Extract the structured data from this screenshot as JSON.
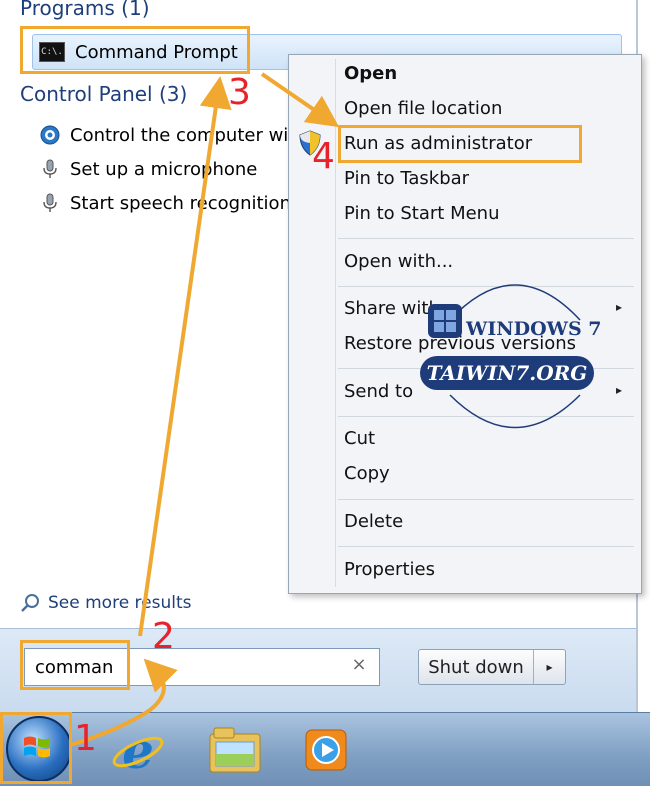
{
  "start_menu": {
    "programs_header": "Programs (1)",
    "command_prompt_label": "Command Prompt",
    "command_prompt_icon_text": "C:\\.",
    "control_panel_header": "Control Panel (3)",
    "control_items": [
      "Control the computer with",
      "Set up a microphone",
      "Start speech recognition"
    ],
    "see_more": "See more results",
    "search_value": "comman",
    "clear_symbol": "×",
    "shutdown_label": "Shut down",
    "shutdown_arrow": "▸"
  },
  "context_menu": {
    "items": [
      {
        "label": "Open",
        "bold": true
      },
      {
        "label": "Open file location"
      },
      {
        "label": "Run as administrator"
      },
      {
        "label": "Pin to Taskbar"
      },
      {
        "label": "Pin to Start Menu"
      },
      {
        "label": "Open with..."
      },
      {
        "label": "Share with",
        "submenu": true
      },
      {
        "label": "Restore previous versions"
      },
      {
        "label": "Send to",
        "submenu": true
      },
      {
        "label": "Cut"
      },
      {
        "label": "Copy"
      },
      {
        "label": "Delete"
      },
      {
        "label": "Properties"
      }
    ],
    "submenu_arrow": "▸"
  },
  "annotations": {
    "step1": "1",
    "step2": "2",
    "step3": "3",
    "step4": "4",
    "highlight_color": "#f0a830",
    "number_color": "#e8222a"
  },
  "watermark": {
    "line1": "WINDOWS 7",
    "line2": "TAIWIN7.ORG"
  },
  "taskbar": {
    "icons": [
      "start-orb-icon",
      "internet-explorer-icon",
      "windows-explorer-icon",
      "media-player-icon"
    ]
  }
}
